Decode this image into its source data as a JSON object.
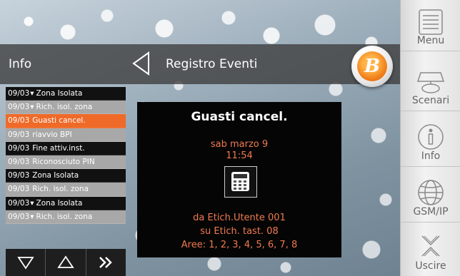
{
  "header": {
    "section_label": "Info",
    "title": "Registro Eventi"
  },
  "events": [
    {
      "date": "09/03",
      "marker": "▾",
      "text": "Zona Isolata",
      "style": "dark"
    },
    {
      "date": "09/03",
      "marker": "▾",
      "text": "Rich. isol. zona",
      "style": "light"
    },
    {
      "date": "09/03",
      "marker": "",
      "text": "Guasti cancel.",
      "style": "selected"
    },
    {
      "date": "09/03",
      "marker": "",
      "text": "riavvio BPI",
      "style": "light"
    },
    {
      "date": "09/03",
      "marker": "",
      "text": "Fine attiv.inst.",
      "style": "dark"
    },
    {
      "date": "09/03",
      "marker": "",
      "text": "Riconosciuto PIN",
      "style": "light"
    },
    {
      "date": "09/03",
      "marker": "",
      "text": "Zona Isolata",
      "style": "dark"
    },
    {
      "date": "09/03",
      "marker": "",
      "text": "Rich. isol. zona",
      "style": "light"
    },
    {
      "date": "09/03",
      "marker": "▾",
      "text": "Zona Isolata",
      "style": "dark"
    },
    {
      "date": "09/03",
      "marker": "▾",
      "text": "Rich. isol. zona",
      "style": "light"
    }
  ],
  "detail": {
    "title": "Guasti cancel.",
    "date": "sab marzo 9",
    "time": "11:54",
    "line1": "da Etich.Utente 001",
    "line2": "su Etich. tast.  08",
    "line3": "Aree: 1, 2, 3, 4, 5, 6, 7, 8",
    "icon": "keypad-icon"
  },
  "nav": {
    "down_icon": "triangle-down-icon",
    "up_icon": "triangle-up-icon",
    "forward_icon": "double-chevron-right-icon"
  },
  "sidebar": {
    "menu": "Menu",
    "scenari": "Scenari",
    "info": "Info",
    "gsm": "GSM/IP",
    "exit": "Uscire"
  },
  "colors": {
    "selected_row": "#ef6a28",
    "detail_text": "#f07a50",
    "logo_orange": "#f07e1a"
  }
}
